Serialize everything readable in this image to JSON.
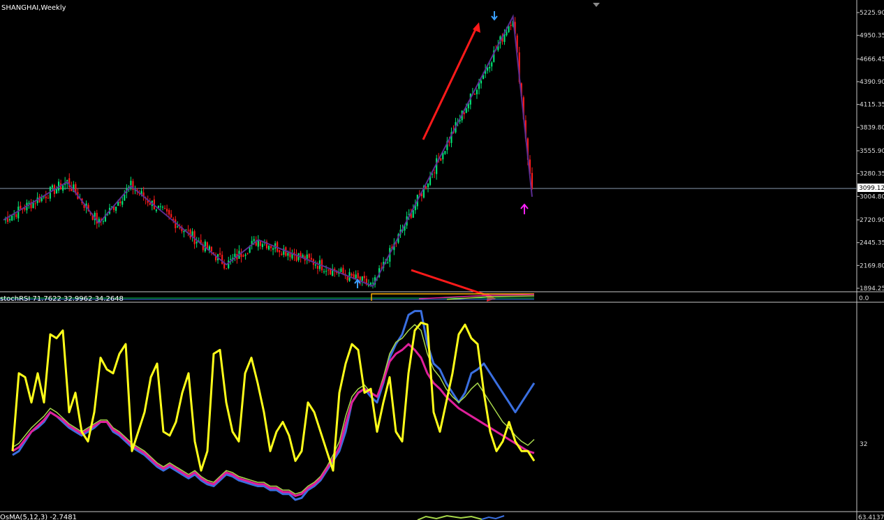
{
  "window": {
    "title": "SHANGHAI,Weekly"
  },
  "colors": {
    "background": "#000000",
    "bull": "#00e676",
    "bear": "#ff1a1a",
    "wick_bull": "#00e676",
    "wick_bear": "#ff1a1a",
    "zigzag": "#5a2d91",
    "arrow": "#ff1a1a",
    "marker_top": "#3aa0ff",
    "marker_bottom": "#ff22ff",
    "axis_text": "#dddddd",
    "stoch_fast": "#ffff1a",
    "stoch_blue": "#3a6fe0",
    "stoch_green": "#a8d84a",
    "stoch_magenta": "#e0209a"
  },
  "price_panel": {
    "current_price_label": "3099.12",
    "current_price": 3099.12,
    "ticks": [
      "5225.90",
      "4950.35",
      "4666.45",
      "4390.90",
      "4115.35",
      "3839.80",
      "3555.90",
      "3280.35",
      "3004.80",
      "2720.90",
      "2445.35",
      "2169.80",
      "1894.25"
    ]
  },
  "stoch_panel": {
    "indicator_label": "stochRSI 71.7622 32.9962 34.2648",
    "scale_label": "32"
  },
  "osma_panel": {
    "indicator_label": "OsMA(5,12,3) -2.7481",
    "scale_label": "63.4137"
  },
  "chart_data": {
    "type": "candlestick",
    "title": "SHANGHAI,Weekly",
    "y_range": [
      1894.25,
      5225.9
    ],
    "zigzag_pivots": [
      {
        "bar": 0,
        "price": 2720
      },
      {
        "bar": 10,
        "price": 3180
      },
      {
        "bar": 15,
        "price": 2680
      },
      {
        "bar": 20,
        "price": 3130
      },
      {
        "bar": 35,
        "price": 2180
      },
      {
        "bar": 40,
        "price": 2480
      },
      {
        "bar": 58,
        "price": 1920
      },
      {
        "bar": 80,
        "price": 5178
      },
      {
        "bar": 83,
        "price": 3000
      }
    ],
    "annotations": [
      {
        "type": "up-arrow",
        "bar": 58,
        "price": 1900
      },
      {
        "type": "down-arrow",
        "bar": 80,
        "price": 5210
      },
      {
        "type": "up-arrow-bottom",
        "bar": 83,
        "price": 2960
      }
    ],
    "stoch_series": [
      {
        "key": "fast",
        "values": [
          30,
          70,
          68,
          55,
          70,
          55,
          90,
          88,
          92,
          50,
          60,
          40,
          35,
          50,
          78,
          72,
          70,
          80,
          85,
          30,
          40,
          50,
          68,
          75,
          40,
          38,
          45,
          60,
          70,
          35,
          20,
          30,
          80,
          82,
          55,
          40,
          35,
          70,
          78,
          65,
          50,
          30,
          40,
          45,
          38,
          25,
          30,
          55,
          50,
          40,
          30,
          20,
          60,
          75,
          85,
          82,
          60,
          62,
          40,
          55,
          68,
          40,
          35,
          70,
          92,
          96,
          95,
          50,
          40,
          55,
          70,
          90,
          95,
          88,
          85,
          60,
          40,
          30,
          35,
          45,
          35,
          30,
          30,
          25
        ]
      },
      {
        "key": "blue",
        "values": [
          28,
          30,
          35,
          40,
          42,
          45,
          50,
          48,
          45,
          42,
          40,
          38,
          40,
          42,
          45,
          45,
          40,
          38,
          35,
          32,
          30,
          28,
          25,
          22,
          20,
          22,
          20,
          18,
          16,
          18,
          15,
          13,
          12,
          15,
          18,
          17,
          15,
          14,
          13,
          12,
          12,
          10,
          10,
          8,
          8,
          5,
          6,
          10,
          12,
          15,
          20,
          25,
          30,
          40,
          55,
          60,
          62,
          58,
          55,
          65,
          78,
          85,
          90,
          100,
          102,
          102,
          85,
          75,
          72,
          65,
          60,
          55,
          60,
          70,
          72,
          75,
          70,
          65,
          60,
          55,
          50,
          55,
          60,
          65
        ]
      },
      {
        "key": "green",
        "values": [
          32,
          34,
          38,
          42,
          45,
          48,
          52,
          50,
          47,
          44,
          42,
          40,
          42,
          44,
          46,
          46,
          42,
          40,
          37,
          34,
          32,
          30,
          27,
          24,
          22,
          24,
          22,
          20,
          18,
          20,
          17,
          15,
          14,
          17,
          20,
          19,
          17,
          16,
          15,
          14,
          14,
          12,
          12,
          10,
          10,
          8,
          9,
          12,
          14,
          17,
          22,
          28,
          35,
          48,
          58,
          62,
          64,
          60,
          58,
          68,
          80,
          86,
          88,
          92,
          95,
          92,
          80,
          72,
          68,
          62,
          58,
          55,
          58,
          62,
          65,
          60,
          55,
          50,
          45,
          42,
          38,
          35,
          33,
          36
        ]
      },
      {
        "key": "magenta",
        "values": [
          30,
          32,
          36,
          40,
          43,
          46,
          50,
          48,
          46,
          43,
          41,
          39,
          41,
          43,
          45,
          45,
          41,
          39,
          36,
          33,
          31,
          29,
          26,
          23,
          21,
          23,
          21,
          19,
          17,
          19,
          16,
          14,
          13,
          16,
          19,
          18,
          16,
          15,
          14,
          13,
          13,
          11,
          11,
          9,
          9,
          7,
          8,
          11,
          13,
          16,
          21,
          26,
          32,
          44,
          55,
          60,
          62,
          60,
          58,
          66,
          76,
          80,
          82,
          85,
          82,
          78,
          70,
          65,
          62,
          58,
          55,
          52,
          50,
          48,
          46,
          44,
          42,
          40,
          38,
          36,
          34,
          32,
          30,
          29
        ]
      }
    ]
  }
}
